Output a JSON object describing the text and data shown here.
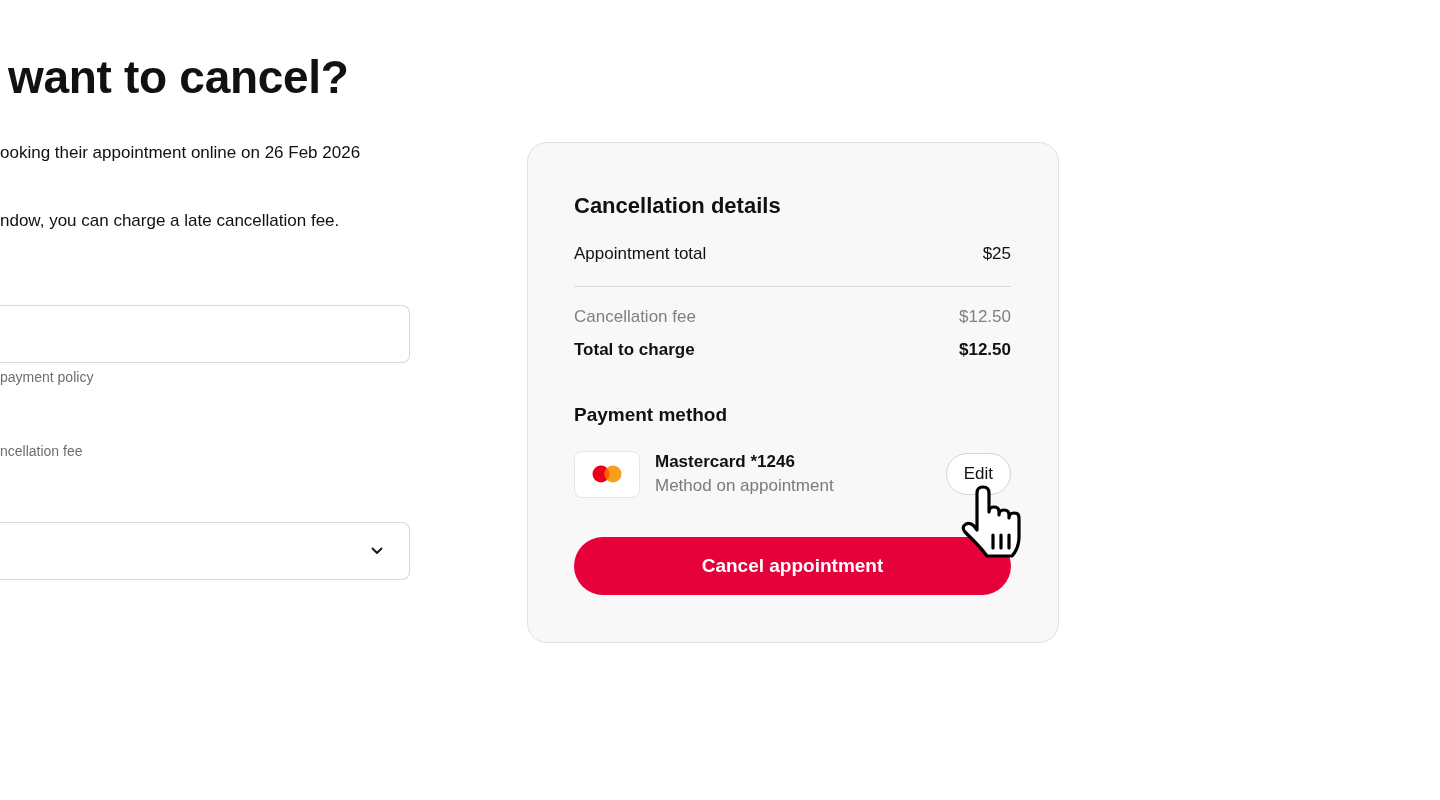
{
  "left": {
    "heading": "want to cancel?",
    "paragraphs": [
      "ooking their appointment online on 26 Feb 2026",
      "ndow, you can charge a late cancellation fee."
    ],
    "amount_field": {
      "helper": "payment policy"
    },
    "note": "ncellation fee"
  },
  "cancellation_details": {
    "title": "Cancellation details",
    "summary": [
      {
        "label": "Appointment total",
        "value": "$25"
      }
    ],
    "charges": [
      {
        "kind": "fee",
        "label": "Cancellation fee",
        "value": "$12.50"
      },
      {
        "kind": "total",
        "label": "Total to charge",
        "value": "$12.50"
      }
    ]
  },
  "payment_method": {
    "title": "Payment method",
    "card_name": "Mastercard *1246",
    "card_note": "Method on appointment",
    "edit_label": "Edit"
  },
  "primary_button": "Cancel appointment"
}
